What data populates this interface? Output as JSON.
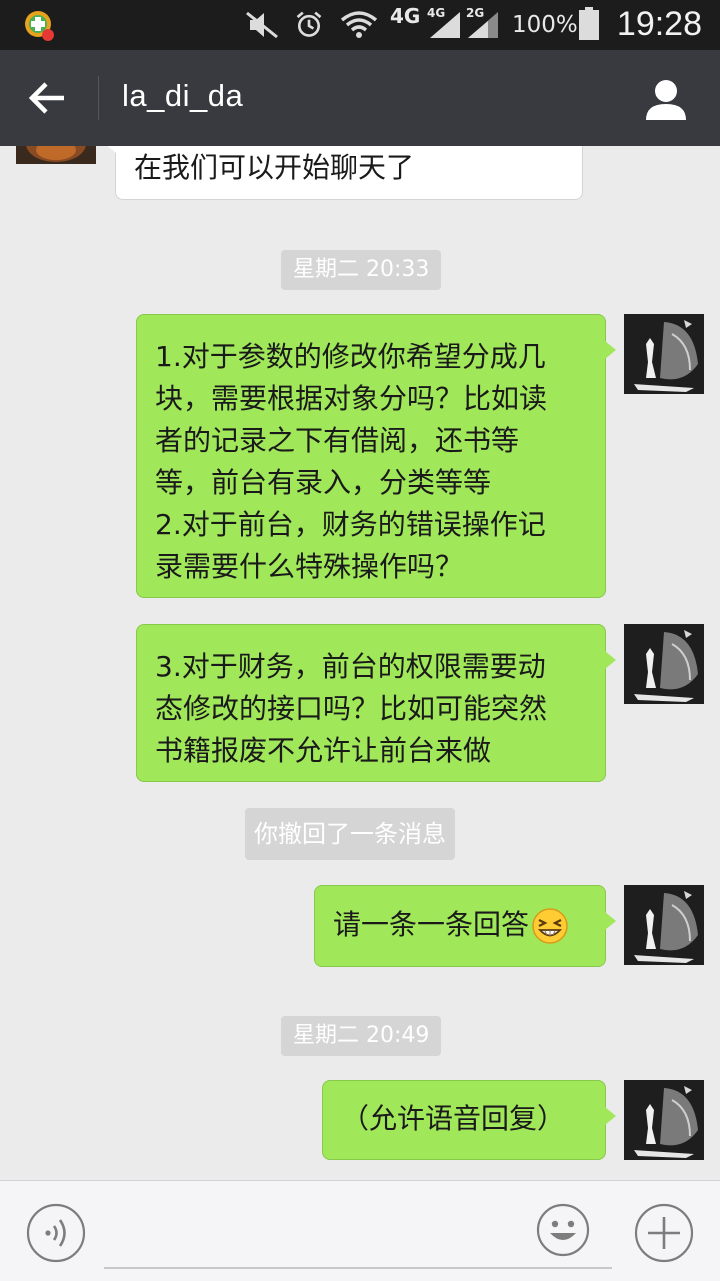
{
  "status_bar": {
    "network_4g": "4G",
    "network_4g_small": "4G",
    "network_2g": "2G",
    "battery": "100%",
    "time": "19:28",
    "icons": [
      "app-notification-icon",
      "silent-icon",
      "alarm-icon",
      "wifi-icon",
      "signal-icon",
      "battery-icon"
    ]
  },
  "header": {
    "title": "la_di_da",
    "back_icon": "arrow-left-icon",
    "profile_icon": "person-icon"
  },
  "messages": {
    "m0": {
      "side": "in",
      "text": "在我们可以开始聊天了"
    },
    "t1": "星期二 20:33",
    "m1": {
      "side": "out",
      "lines": [
        "1.对于参数的修改你希望分成几",
        "块，需要根据对象分吗？比如读",
        "者的记录之下有借阅，还书等",
        "等，前台有录入，分类等等",
        "2.对于前台，财务的错误操作记",
        "录需要什么特殊操作吗？"
      ]
    },
    "m2": {
      "side": "out",
      "lines": [
        "3.对于财务，前台的权限需要动",
        "态修改的接口吗？比如可能突然",
        "书籍报废不允许让前台来做"
      ]
    },
    "recall": "你撤回了一条消息",
    "m3": {
      "side": "out",
      "text": "请一条一条回答",
      "emoji": "grinning-squint-emoji"
    },
    "t2": "星期二 20:49",
    "m4": {
      "side": "out",
      "text": "（允许语音回复）"
    }
  },
  "input_bar": {
    "placeholder": "",
    "voice_icon": "voice-icon",
    "emoji_icon": "emoji-icon",
    "plus_icon": "plus-icon"
  },
  "colors": {
    "status_bar_bg": "#1c1c1c",
    "title_bar_bg": "#393a3f",
    "chat_bg": "#ebebeb",
    "outgoing_bubble": "#a0e75a",
    "incoming_bubble": "#ffffff",
    "time_chip": "#d5d5d5"
  }
}
